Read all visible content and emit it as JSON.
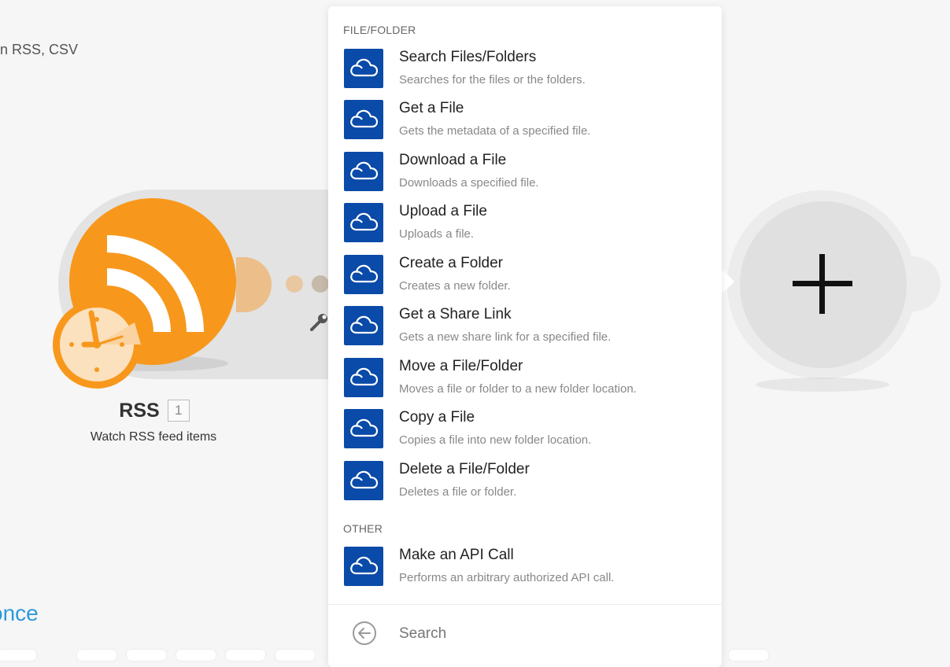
{
  "canvas": {
    "scenario_desc": "ion RSS, CSV",
    "run_once": "once"
  },
  "rss_module": {
    "name": "RSS",
    "badge": "1",
    "subtitle": "Watch RSS feed items"
  },
  "colors": {
    "rss_orange": "#f7981d",
    "onedrive_blue": "#0a4aa8",
    "link_blue": "#2c9ad8"
  },
  "menu": {
    "sections": [
      {
        "title": "FILE/FOLDER",
        "items": [
          {
            "title": "Search Files/Folders",
            "desc": "Searches for the files or the folders.",
            "icon": "cloud-icon"
          },
          {
            "title": "Get a File",
            "desc": "Gets the metadata of a specified file.",
            "icon": "cloud-icon"
          },
          {
            "title": "Download a File",
            "desc": "Downloads a specified file.",
            "icon": "cloud-icon"
          },
          {
            "title": "Upload a File",
            "desc": "Uploads a file.",
            "icon": "cloud-icon"
          },
          {
            "title": "Create a Folder",
            "desc": "Creates a new folder.",
            "icon": "cloud-icon"
          },
          {
            "title": "Get a Share Link",
            "desc": "Gets a new share link for a specified file.",
            "icon": "cloud-icon"
          },
          {
            "title": "Move a File/Folder",
            "desc": "Moves a file or folder to a new folder location.",
            "icon": "cloud-icon"
          },
          {
            "title": "Copy a File",
            "desc": "Copies a file into new folder location.",
            "icon": "cloud-icon"
          },
          {
            "title": "Delete a File/Folder",
            "desc": "Deletes a file or folder.",
            "icon": "cloud-icon"
          }
        ]
      },
      {
        "title": "OTHER",
        "items": [
          {
            "title": "Make an API Call",
            "desc": "Performs an arbitrary authorized API call.",
            "icon": "cloud-icon"
          }
        ]
      }
    ],
    "search_placeholder": "Search"
  }
}
